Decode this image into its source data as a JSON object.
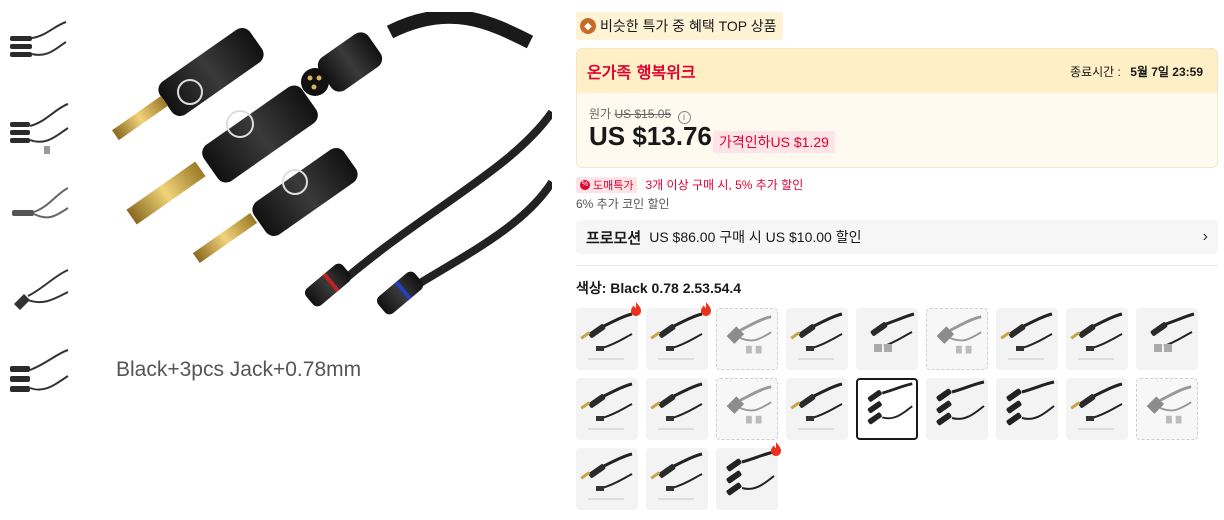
{
  "gallery": {
    "thumbnails": [
      {
        "name": "thumb-1"
      },
      {
        "name": "thumb-2"
      },
      {
        "name": "thumb-3"
      },
      {
        "name": "thumb-4"
      },
      {
        "name": "thumb-5"
      }
    ],
    "main_caption": "Black+3pcs Jack+0.78mm"
  },
  "badge": {
    "icon": "fire-badge-icon",
    "text": "비슷한 특가 중 혜택 TOP 상품"
  },
  "promo_event": {
    "name": "온가족 행복위크",
    "deadline_label": "종료시간 :",
    "deadline_value": "5월 7일 23:59"
  },
  "pricing": {
    "original_label": "원가",
    "original_price": "US $15.05",
    "current_price": "US $13.76",
    "discount": "가격인하US $1.29",
    "colors": {
      "accent": "#e10030",
      "header_bg": "#ffefc6",
      "box_bg": "#fffaf0"
    }
  },
  "bulk": {
    "tag": "도매특가",
    "text": "3개 이상 구매 시, 5% 추가 할인",
    "coin_text": "6% 추가 코인 할인"
  },
  "promotion": {
    "label": "프로모션",
    "text": "US $86.00 구매 시 US $10.00 할인",
    "chevron": "chevron-right-icon"
  },
  "color": {
    "label": "색상: Black 0.78 2.53.54.4",
    "swatches": [
      {
        "variant": "black-2pin",
        "hot": true
      },
      {
        "variant": "black-2pin",
        "hot": true
      },
      {
        "variant": "grey-angle",
        "dashed": true
      },
      {
        "variant": "black-2pin"
      },
      {
        "variant": "black-mmcx"
      },
      {
        "variant": "grey-angle",
        "dashed": true
      },
      {
        "variant": "black-2pin"
      },
      {
        "variant": "black-2pin"
      },
      {
        "variant": "black-mmcx"
      },
      {
        "variant": "black-2pin"
      },
      {
        "variant": "black-2pin"
      },
      {
        "variant": "grey-angle",
        "dashed": true
      },
      {
        "variant": "black-2pin"
      },
      {
        "variant": "black-3jack",
        "selected": true
      },
      {
        "variant": "black-3jack"
      },
      {
        "variant": "black-3jack"
      },
      {
        "variant": "black-2pin"
      },
      {
        "variant": "grey-angle",
        "dashed": true
      },
      {
        "variant": "black-2pin"
      },
      {
        "variant": "black-2pin"
      },
      {
        "variant": "black-3jack",
        "hot": true
      }
    ]
  }
}
